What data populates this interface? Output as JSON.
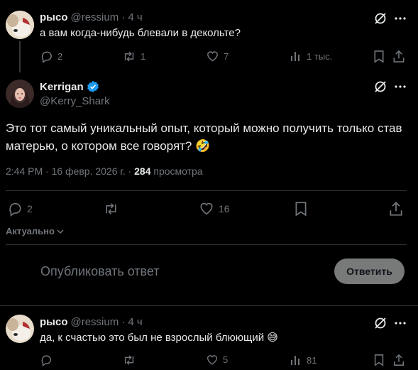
{
  "tweet1": {
    "display_name": "рысо",
    "handle": "@ressium",
    "time": "· 4 ч",
    "text": "а вам когда-нибудь блевали в декольте?",
    "replies": "2",
    "retweets": "1",
    "likes": "7",
    "views": "1 тыс."
  },
  "main": {
    "display_name": "Kerrigan",
    "handle": "@Kerry_Shark",
    "text_line1": "Это тот самый уникальный опыт, который можно получить только став",
    "text_line2": "матерью, о котором все говорят?",
    "emoji": "🤣",
    "timestamp": "2:44 PM · 16 февр. 2026 г. · ",
    "views_count": "284",
    "views_label": " просмотра",
    "replies": "2",
    "likes": "16"
  },
  "sort": {
    "label": "Актуально"
  },
  "compose": {
    "placeholder": "Опубликовать ответ",
    "button": "Ответить"
  },
  "tweet2": {
    "display_name": "рысо",
    "handle": "@ressium",
    "time": "· 4 ч",
    "text": "да, к счастью это был не взрослый блюющий",
    "emoji": "😅",
    "likes": "5",
    "views": "81"
  },
  "colors": {
    "verified": "#1d9bf0",
    "muted": "#71767b",
    "text": "#e7e9ea",
    "reply_button": "#787a7a"
  }
}
